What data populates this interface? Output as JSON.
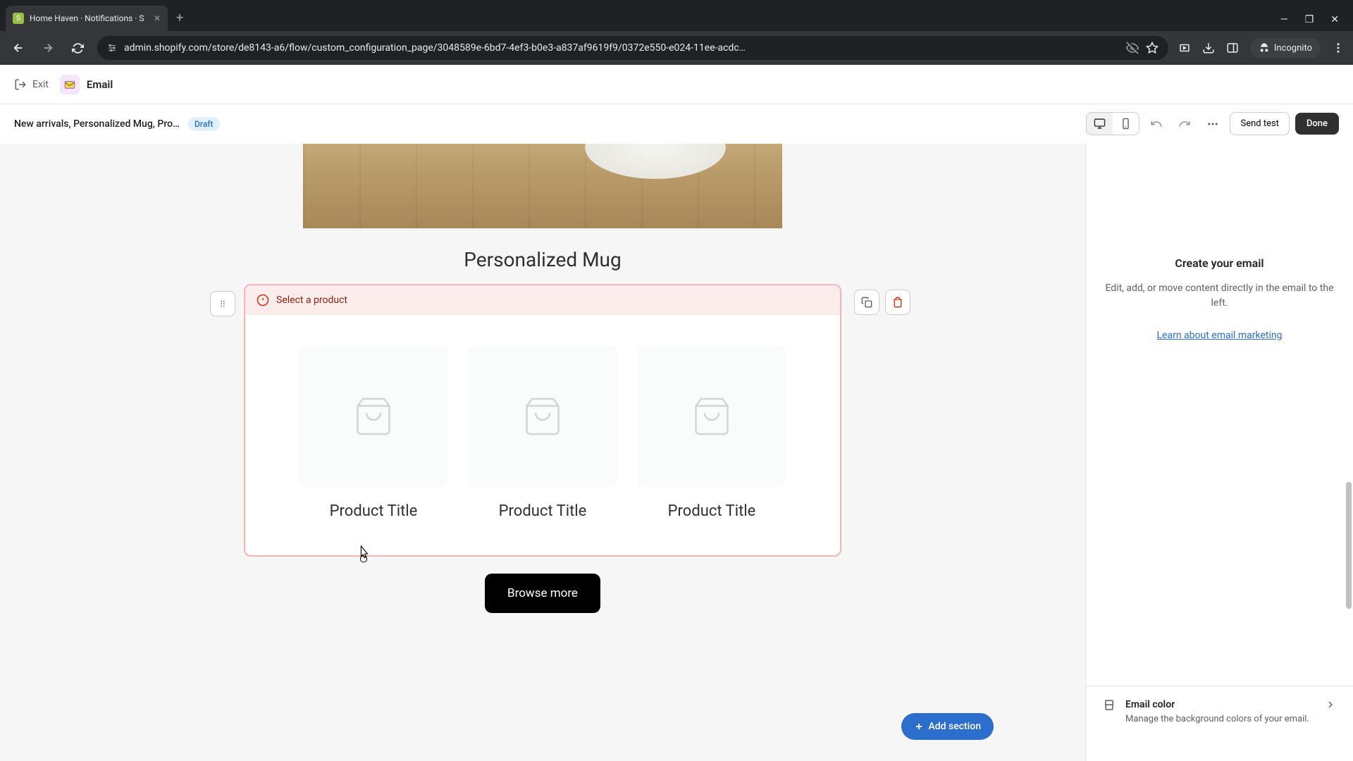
{
  "browser": {
    "tab_title": "Home Haven · Notifications · S",
    "url": "admin.shopify.com/store/de8143-a6/flow/custom_configuration_page/3048589e-6bd7-4ef3-b0e3-a837af9619f9/0372e550-e024-11ee-acdc…",
    "incognito_label": "Incognito"
  },
  "app_header": {
    "exit_label": "Exit",
    "email_label": "Email"
  },
  "toolbar": {
    "title": "New arrivals, Personalized Mug, Pro…",
    "draft_label": "Draft",
    "send_test_label": "Send test",
    "done_label": "Done"
  },
  "canvas": {
    "product_heading": "Personalized Mug",
    "warning_text": "Select a product",
    "products": [
      {
        "title": "Product Title"
      },
      {
        "title": "Product Title"
      },
      {
        "title": "Product Title"
      }
    ],
    "browse_label": "Browse more",
    "add_section_label": "Add section"
  },
  "sidebar": {
    "heading": "Create your email",
    "description": "Edit, add, or move content directly in the email to the left.",
    "link_text": "Learn about email marketing",
    "email_color_label": "Email color",
    "email_color_desc": "Manage the background colors of your email."
  }
}
